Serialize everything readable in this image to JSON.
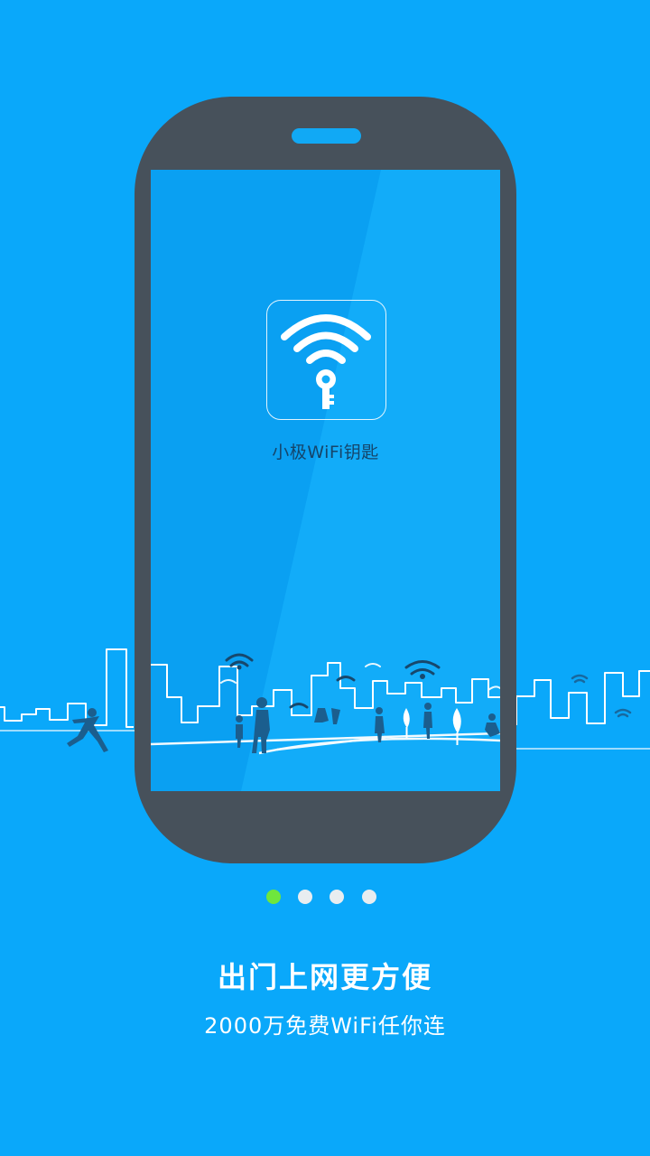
{
  "phone": {
    "app": {
      "name": "小极WiFi钥匙",
      "icon": "wifi-key-icon"
    }
  },
  "pager": {
    "count": 4,
    "active_index": 0
  },
  "onboarding": {
    "title": "出门上网更方便",
    "subtitle": "2000万免费WiFi任你连"
  },
  "colors": {
    "background": "#0aa8fa",
    "phone_body": "#47515b",
    "screen": "#12acf9",
    "active_dot": "#6fe63d",
    "inactive_dot": "#e8edf0"
  }
}
